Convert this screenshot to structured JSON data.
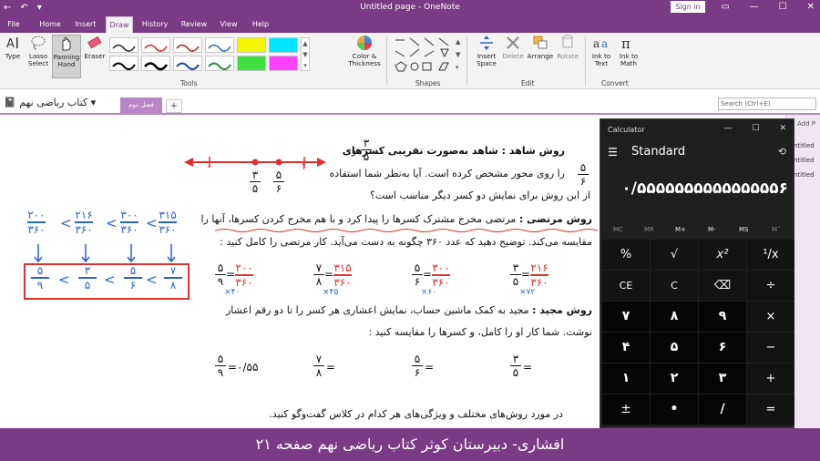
{
  "titlebar": {
    "title": "Untitled page - OneNote",
    "sign_in": "Sign in"
  },
  "tabs": [
    "File",
    "Home",
    "Insert",
    "Draw",
    "History",
    "Review",
    "View",
    "Help"
  ],
  "ribbon": {
    "type_label": "Type",
    "lasso_label": "Lasso",
    "lasso_label2": "Select",
    "panning_label": "Panning",
    "panning_label2": "Hand",
    "eraser_label": "Eraser",
    "color_thickness": "Color &",
    "color_thickness2": "Thickness",
    "insert_space": "Insert",
    "insert_space2": "Space",
    "delete": "Delete",
    "arrange": "Arrange",
    "rotate": "Rotate",
    "ink_to_text": "Ink to",
    "ink_to_text2": "Text",
    "ink_to_math": "Ink to",
    "ink_to_math2": "Math",
    "groups": {
      "tools": "Tools",
      "shapes": "Shapes",
      "edit": "Edit",
      "convert": "Convert"
    }
  },
  "notebook": {
    "name": "کتاب ریاضی نهم",
    "section_tab": "فصل دوم",
    "search_placeholder": "Search (Ctrl+E)"
  },
  "pagelist": {
    "add_page": "Add P",
    "pages": [
      "ntitled",
      "ntitled",
      "ntitled"
    ]
  },
  "page": {
    "line1": "روش شاهد : شاهد به‌صورت تقریبی کسرهای",
    "line1_and": "و",
    "line2": "را روی محور مشخص کرده است. آیا به‌نظر شما استفاده",
    "line3": "از این روش برای نمایش دو کسر دیگر مناسب است؟",
    "morteza_title": "روش مرتضی :",
    "morteza_text": "مرتضی مخرج مشترک کسرها را پیدا کرد و با هم مخرج کردن کسرها، آنها را",
    "morteza_line2": "مقایسه می‌کند. توضیح دهید که عدد ۳۶۰ چگونه به دست می‌آید. کار مرتضی را کامل کنید :",
    "majid_title": "روش مجید :",
    "majid_text": "مجید به کمک ماشین حساب، نمایش اعشاری هر کسر را تا دو رقم اعشار",
    "majid_line2": "نوشت. شما کار او را کامل، و کسرها را مقایسه کنید :",
    "final_line": "در مورد روش‌های مختلف و ویژگی‌های هر کدام در کلاس گفت‌وگو کنید.",
    "frac1": {
      "num": "۳",
      "den": "۵"
    },
    "frac2": {
      "num": "۵",
      "den": "۶"
    },
    "numberline": {
      "zero": "۰",
      "one": "۱",
      "t1n": "۳",
      "t1d": "۵",
      "t2n": "۵",
      "t2d": "۶"
    },
    "eq": [
      {
        "num": "۵",
        "den": "۹",
        "rn": "۲۰۰",
        "rd": "۳۶۰",
        "mult": "×۴۰"
      },
      {
        "num": "۷",
        "den": "۸",
        "rn": "۳۱۵",
        "rd": "۳۶۰",
        "mult": "×۴۵"
      },
      {
        "num": "۵",
        "den": "۶",
        "rn": "۳۰۰",
        "rd": "۳۶۰",
        "mult": "×۶۰"
      },
      {
        "num": "۳",
        "den": "۵",
        "rn": "۲۱۶",
        "rd": "۳۶۰",
        "mult": "×۷۲"
      }
    ],
    "dec": [
      {
        "num": "۵",
        "den": "۹",
        "val": "=۰/۵۵"
      },
      {
        "num": "۷",
        "den": "۸",
        "val": "="
      },
      {
        "num": "۵",
        "den": "۶",
        "val": "="
      },
      {
        "num": "۳",
        "den": "۵",
        "val": "="
      }
    ],
    "hw_top": [
      {
        "n": "۲۰۰",
        "d": "۳۶۰"
      },
      {
        "n": "۲۱۶",
        "d": "۳۶۰"
      },
      {
        "n": "۳۰۰",
        "d": "۳۶۰"
      },
      {
        "n": "۳۱۵",
        "d": "۳۶۰"
      }
    ],
    "hw_bottom": [
      {
        "n": "۵",
        "d": "۹"
      },
      {
        "n": "۳",
        "d": "۵"
      },
      {
        "n": "۵",
        "d": "۶"
      },
      {
        "n": "۷",
        "d": "۸"
      }
    ],
    "lt": "<"
  },
  "calculator": {
    "title": "Calculator",
    "mode": "Standard",
    "display": "۰/۵۵۵۵۵۵۵۵۵۵۵۵۵۵۵۶",
    "memory": [
      "MC",
      "MR",
      "M+",
      "M-",
      "MS",
      "M˅"
    ],
    "keys": [
      [
        "%",
        "√",
        "x²",
        "¹/x"
      ],
      [
        "CE",
        "C",
        "⌫",
        "÷"
      ],
      [
        "۷",
        "۸",
        "۹",
        "×"
      ],
      [
        "۴",
        "۵",
        "۶",
        "−"
      ],
      [
        "۱",
        "۲",
        "۳",
        "+"
      ],
      [
        "±",
        "•",
        "/",
        "="
      ]
    ]
  },
  "banner": "افشاری- دبیرستان کوثر کتاب ریاضی نهم صفحه ۲۱",
  "colors": {
    "accent": "#7b3a85",
    "ink_blue": "#2b63c4",
    "ink_red": "#e03131"
  }
}
